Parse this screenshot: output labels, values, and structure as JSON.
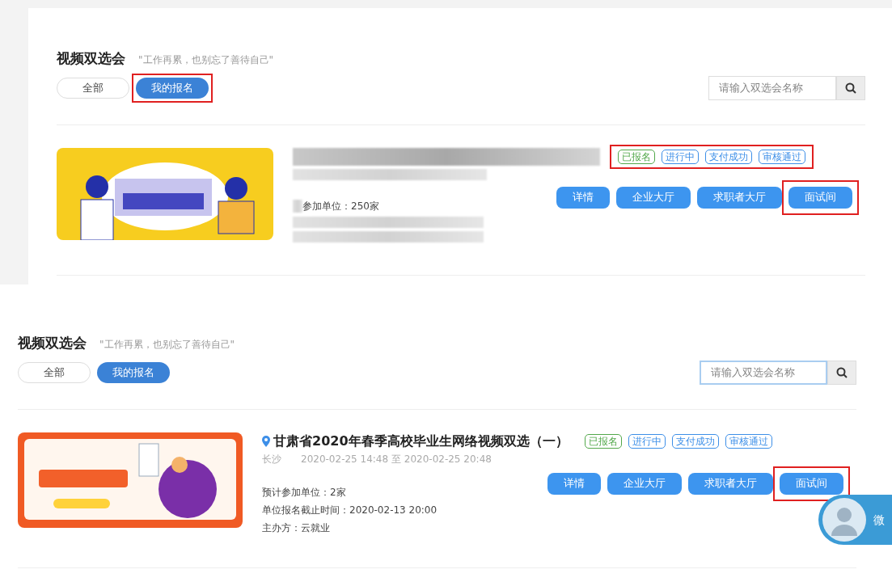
{
  "panels": [
    {
      "heading": "视频双选会",
      "motto": "\"工作再累，也别忘了善待自己\"",
      "tabs": [
        {
          "label": "全部",
          "selected": false,
          "highlighted": false
        },
        {
          "label": "我的报名",
          "selected": true,
          "highlighted": true
        }
      ],
      "search": {
        "placeholder": "请输入双选会名称",
        "focused": false
      },
      "fair": {
        "redacted": true,
        "kind": "yellow",
        "lines": [
          "参加单位：250家"
        ],
        "tags_highlighted": true,
        "tags": [
          {
            "label": "已报名",
            "color": "#52a84a"
          },
          {
            "label": "进行中",
            "color": "#3d8fe8"
          },
          {
            "label": "支付成功",
            "color": "#3d8fe8"
          },
          {
            "label": "审核通过",
            "color": "#3d8fe8"
          }
        ],
        "buttons": [
          {
            "label": "详情",
            "highlighted": false
          },
          {
            "label": "企业大厅",
            "highlighted": false
          },
          {
            "label": "求职者大厅",
            "highlighted": false
          },
          {
            "label": "面试间",
            "highlighted": true
          }
        ]
      }
    },
    {
      "heading": "视频双选会",
      "motto": "\"工作再累，也别忘了善待自己\"",
      "tabs": [
        {
          "label": "全部",
          "selected": false,
          "highlighted": false
        },
        {
          "label": "我的报名",
          "selected": true,
          "highlighted": false
        }
      ],
      "search": {
        "placeholder": "请输入双选会名称",
        "focused": true
      },
      "fair": {
        "redacted": false,
        "kind": "orange",
        "title": "甘肃省2020年春季高校毕业生网络视频双选（一）",
        "city": "长沙",
        "dates": "2020-02-25 14:48 至 2020-02-25 20:48",
        "lines": [
          "预计参加单位：2家",
          "单位报名截止时间：2020-02-13 20:00",
          "主办方：云就业"
        ],
        "tags_highlighted": false,
        "tags": [
          {
            "label": "已报名",
            "color": "#52a84a"
          },
          {
            "label": "进行中",
            "color": "#3d8fe8"
          },
          {
            "label": "支付成功",
            "color": "#3d8fe8"
          },
          {
            "label": "审核通过",
            "color": "#3d8fe8"
          }
        ],
        "buttons": [
          {
            "label": "详情",
            "highlighted": false
          },
          {
            "label": "企业大厅",
            "highlighted": false
          },
          {
            "label": "求职者大厅",
            "highlighted": false
          },
          {
            "label": "面试间",
            "highlighted": true
          }
        ]
      },
      "service_widget": {
        "label": "微"
      }
    }
  ]
}
